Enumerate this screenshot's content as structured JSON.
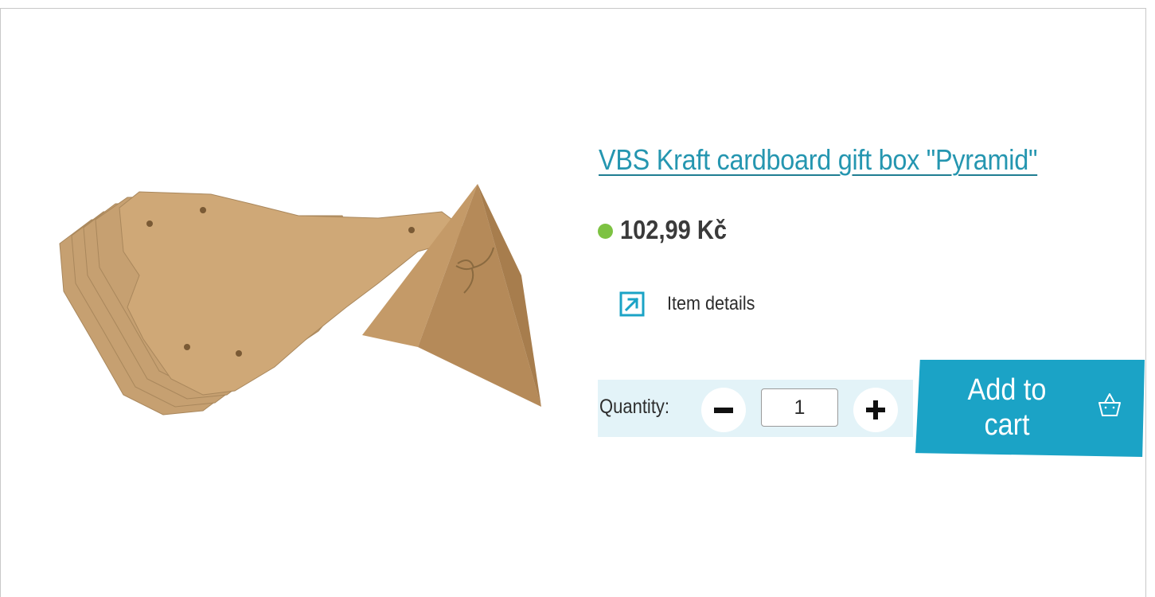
{
  "product": {
    "title": "VBS Kraft cardboard gift box \"Pyramid\"",
    "price": "102,99 Kč",
    "stock_color": "#7dc242",
    "image_alt": "kraft-cardboard-pyramid-gift-boxes"
  },
  "details": {
    "label": "Item details",
    "icon": "external-arrow-icon"
  },
  "quantity": {
    "label": "Quantity:",
    "value": "1",
    "minus_icon": "minus-icon",
    "plus_icon": "plus-icon"
  },
  "cart": {
    "label": "Add to cart",
    "icon": "basket-icon",
    "color": "#1ba3c6"
  },
  "colors": {
    "link": "#2596b0",
    "panel": "#e3f3f8",
    "accent": "#1ba3c6"
  }
}
